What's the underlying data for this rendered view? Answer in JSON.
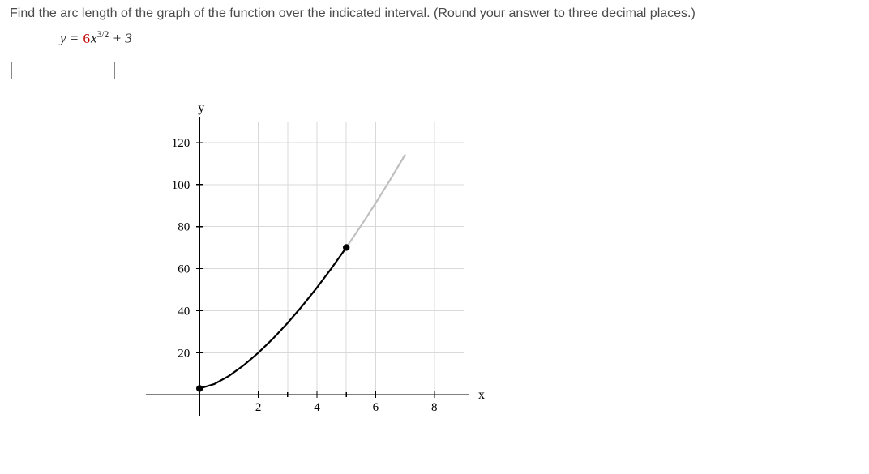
{
  "problem": {
    "prompt": "Find the arc length of the graph of the function over the indicated interval. (Round your answer to three decimal places.)",
    "equation": {
      "lhs": "y",
      "eq": "=",
      "coef": "6",
      "var": "x",
      "exp": "3/2",
      "tail": " + 3"
    }
  },
  "chart_data": {
    "type": "line",
    "title": "",
    "xlabel": "x",
    "ylabel": "y",
    "xlim": [
      -1,
      9
    ],
    "ylim": [
      -8,
      130
    ],
    "xticks": [
      2,
      4,
      6,
      8
    ],
    "yticks": [
      20,
      40,
      60,
      80,
      100,
      120
    ],
    "interval": [
      0,
      5
    ],
    "series": [
      {
        "name": "y = 6x^(3/2) + 3",
        "x": [
          0,
          0.5,
          1,
          1.5,
          2,
          2.5,
          3,
          3.5,
          4,
          4.5,
          5,
          5.5,
          6,
          6.5,
          7
        ],
        "values": [
          3,
          5.121,
          9,
          14.023,
          19.971,
          26.717,
          34.177,
          42.285,
          51,
          60.274,
          70.082,
          80.395,
          91.182,
          102.42,
          114.1
        ]
      }
    ],
    "endpoints": [
      {
        "x": 0,
        "y": 3
      },
      {
        "x": 5,
        "y": 70.082
      }
    ]
  }
}
